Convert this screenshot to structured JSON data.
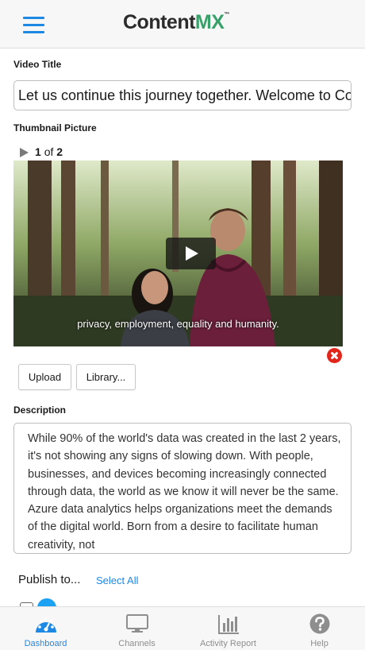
{
  "header": {
    "logo_main": "Content",
    "logo_accent": "MX",
    "logo_tm": "™"
  },
  "form": {
    "video_title_label": "Video Title",
    "video_title_value": "Let us continue this journey together. Welcome to Co",
    "thumbnail_label": "Thumbnail Picture",
    "pager": {
      "current": "1",
      "of_text": "of",
      "total": "2"
    },
    "thumbnail_caption": "privacy, employment, equality and humanity.",
    "upload_label": "Upload",
    "library_label": "Library...",
    "description_label": "Description",
    "description_value": "While 90% of the world's data was created in the last 2 years, it's not showing any signs of slowing down. With people, businesses, and devices becoming increasingly connected through data, the world as we know it will never be the same. Azure data analytics helps organizations meet the demands of the digital world. Born from a desire to facilitate human creativity, not",
    "publish_label": "Publish to...",
    "select_all_label": "Select All"
  },
  "tabbar": {
    "tabs": [
      {
        "label": "Dashboard",
        "icon": "dashboard-gauge-icon",
        "active": true
      },
      {
        "label": "Channels",
        "icon": "monitor-icon",
        "active": false
      },
      {
        "label": "Activity Report",
        "icon": "bar-chart-icon",
        "active": false
      },
      {
        "label": "Help",
        "icon": "help-circle-icon",
        "active": false
      }
    ]
  },
  "colors": {
    "accent": "#1e88e5",
    "brand_green": "#38a169",
    "remove_red": "#e2261c",
    "twitter_blue": "#1da1f2"
  }
}
